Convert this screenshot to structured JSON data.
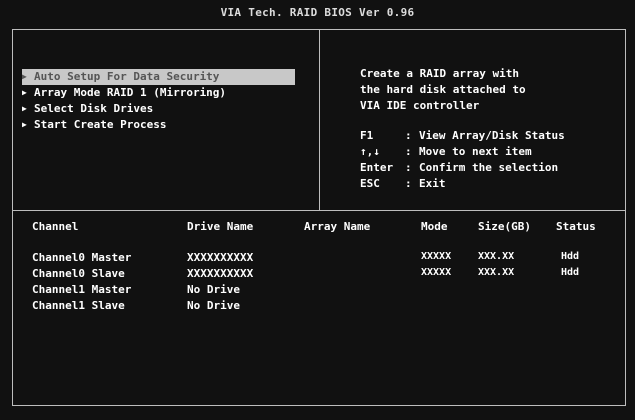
{
  "title": "VIA Tech. RAID BIOS Ver 0.96",
  "menu": [
    {
      "label": "Auto Setup For Data Security",
      "selected": true
    },
    {
      "label": "Array Mode RAID 1 (Mirroring)",
      "selected": false
    },
    {
      "label": "Select Disk Drives",
      "selected": false
    },
    {
      "label": "Start Create Process",
      "selected": false
    }
  ],
  "help": {
    "description": [
      "Create a RAID array with",
      "the hard disk attached to",
      "VIA IDE controller"
    ],
    "keys": [
      {
        "key": "F1",
        "sep": ":",
        "action": "View Array/Disk Status"
      },
      {
        "key": "↑,↓",
        "sep": ":",
        "action": "Move to next item"
      },
      {
        "key": "Enter",
        "sep": ":",
        "action": "Confirm the selection"
      },
      {
        "key": "ESC",
        "sep": ":",
        "action": "Exit"
      }
    ]
  },
  "table": {
    "headers": {
      "channel": "Channel",
      "drive_name": "Drive Name",
      "array_name": "Array Name",
      "mode": "Mode",
      "size": "Size(GB)",
      "status": "Status"
    },
    "rows": [
      {
        "channel": "Channel0 Master",
        "drive_name": "XXXXXXXXXX",
        "array_name": "",
        "mode": "XXXXX",
        "size": "XXX.XX",
        "status": "Hdd"
      },
      {
        "channel": "Channel0 Slave",
        "drive_name": "XXXXXXXXXX",
        "array_name": "",
        "mode": "XXXXX",
        "size": "XXX.XX",
        "status": "Hdd"
      },
      {
        "channel": "Channel1 Master",
        "drive_name": "No Drive",
        "array_name": "",
        "mode": "",
        "size": "",
        "status": ""
      },
      {
        "channel": "Channel1 Slave",
        "drive_name": "No Drive",
        "array_name": "",
        "mode": "",
        "size": "",
        "status": ""
      }
    ]
  },
  "colors": {
    "background": "#111111",
    "text": "#ffffff",
    "border": "#bdbdbd",
    "highlight_bg": "#c8c8c8",
    "highlight_text": "#555555"
  }
}
